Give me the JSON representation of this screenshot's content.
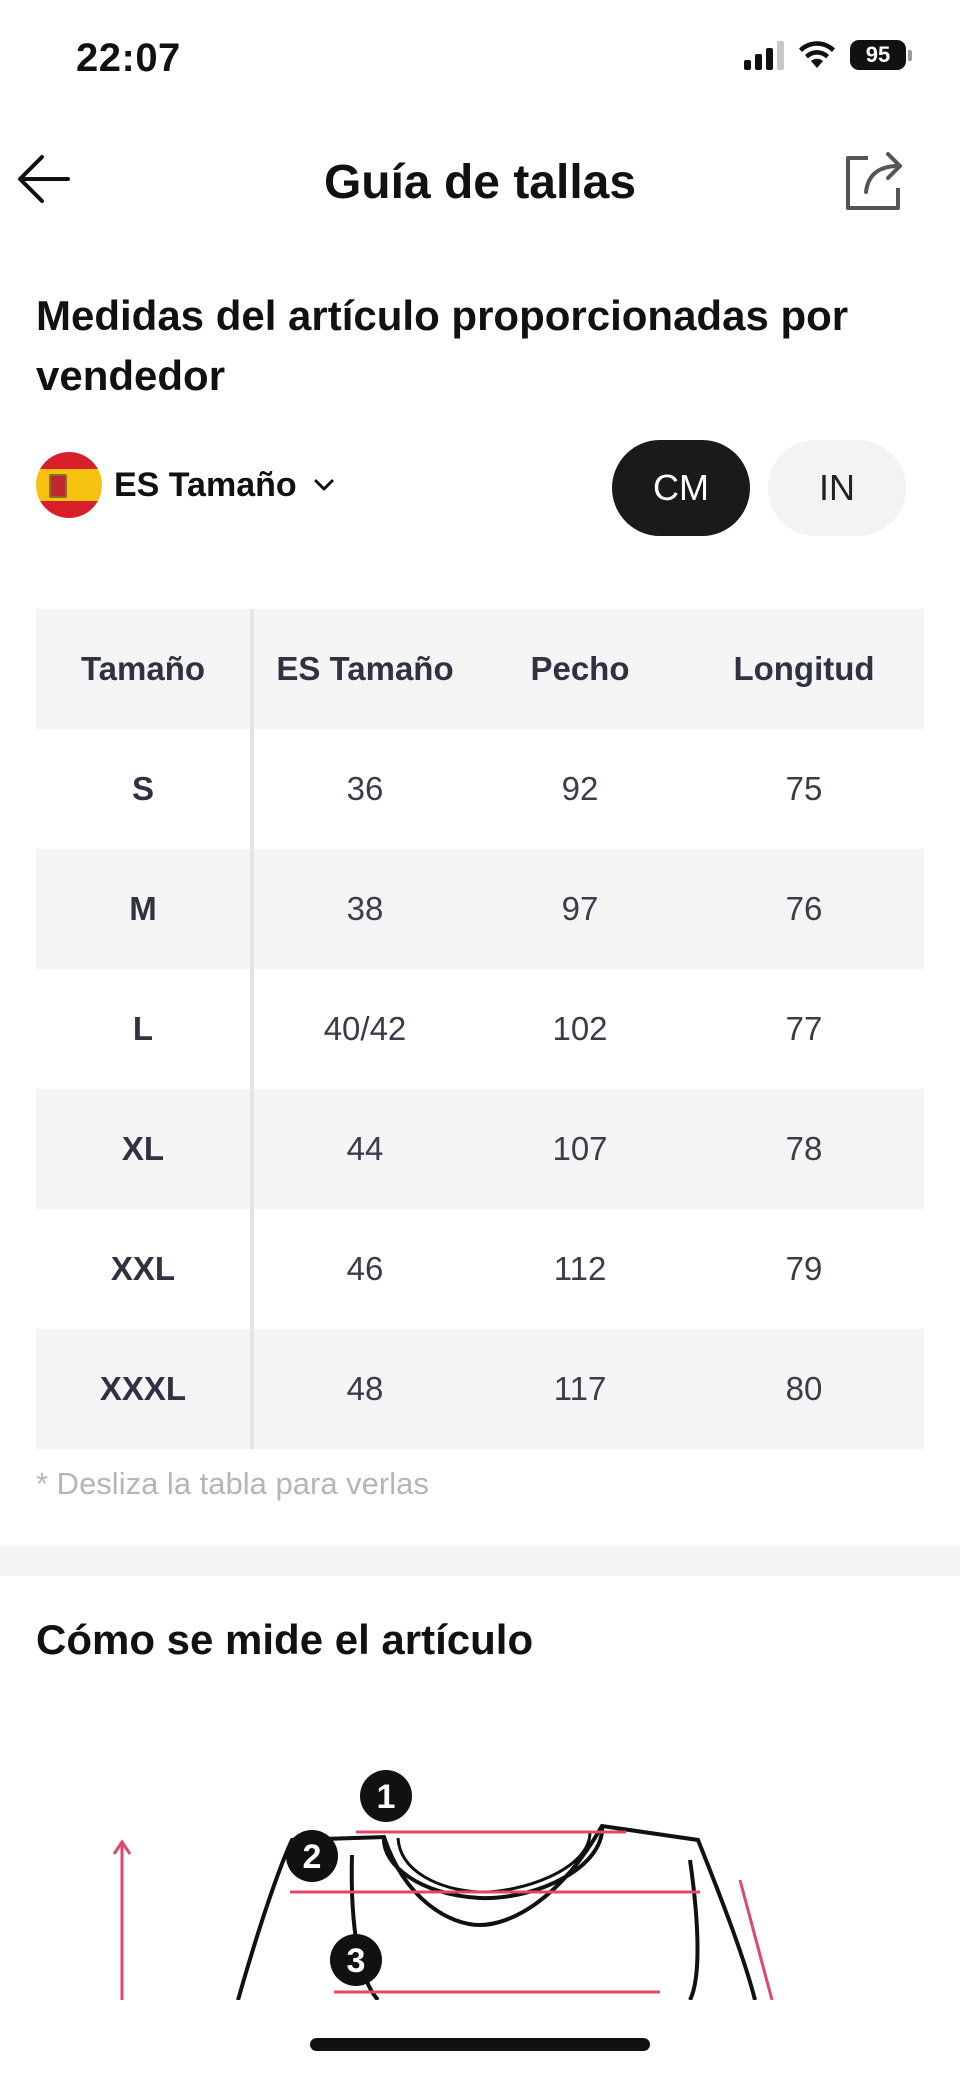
{
  "status_bar": {
    "time": "22:07",
    "battery": "95",
    "icons": [
      "signal-icon",
      "wifi-icon",
      "battery-icon"
    ]
  },
  "header": {
    "title": "Guía de tallas",
    "back_icon": "arrow-left-icon",
    "share_icon": "share-icon"
  },
  "seller_section": {
    "title": "Medidas del artículo proporcionadas por vendedor",
    "size_system": {
      "flag_icon": "spain-flag-icon",
      "label": "ES Tamaño",
      "chevron_icon": "chevron-down-icon"
    },
    "units": [
      {
        "label": "CM",
        "selected": true
      },
      {
        "label": "IN",
        "selected": false
      }
    ]
  },
  "size_table": {
    "headers": [
      "Tamaño",
      "ES Tamaño",
      "Pecho",
      "Longitud"
    ],
    "rows": [
      [
        "S",
        "36",
        "92",
        "75"
      ],
      [
        "M",
        "38",
        "97",
        "76"
      ],
      [
        "L",
        "40/42",
        "102",
        "77"
      ],
      [
        "XL",
        "44",
        "107",
        "78"
      ],
      [
        "XXL",
        "46",
        "112",
        "79"
      ],
      [
        "XXXL",
        "48",
        "117",
        "80"
      ]
    ]
  },
  "hint": "* Desliza la tabla para verlas",
  "measure_section": {
    "title": "Cómo se mide el artículo",
    "markers": [
      "1",
      "2",
      "3"
    ]
  },
  "colors": {
    "accent_dark": "#1a1a1a",
    "row_shade": "#f5f5f5",
    "measure_line": "#e0486a"
  }
}
